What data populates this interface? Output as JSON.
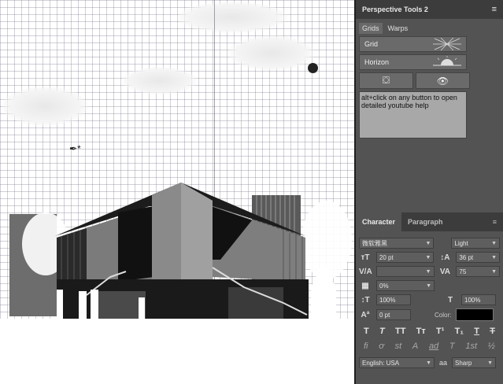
{
  "perspective_panel": {
    "title": "Perspective Tools 2",
    "tabs": [
      "Grids",
      "Warps"
    ],
    "grid_button": "Grid",
    "horizon_button": "Horizon",
    "help_text": "alt+click on any button to open detailed youtube help"
  },
  "character_panel": {
    "tabs": [
      "Character",
      "Paragraph"
    ],
    "font_family": "微软雅黑",
    "font_style": "Light",
    "font_size": "20 pt",
    "leading": "36 pt",
    "kerning": "",
    "tracking": "75",
    "tsume": "0%",
    "vertical_scale": "100%",
    "horizontal_scale": "100%",
    "baseline_shift": "0 pt",
    "color_label": "Color:",
    "color_value": "#000000",
    "style_glyphs": [
      "T",
      "T",
      "TT",
      "Tт",
      "T¹",
      "T₁",
      "T",
      "T"
    ],
    "opentype_glyphs": [
      "fi",
      "ơ",
      "st",
      "A",
      "ad",
      "T",
      "1st",
      "½"
    ],
    "language": "English: USA",
    "aa_label": "aa",
    "antialias": "Sharp"
  }
}
